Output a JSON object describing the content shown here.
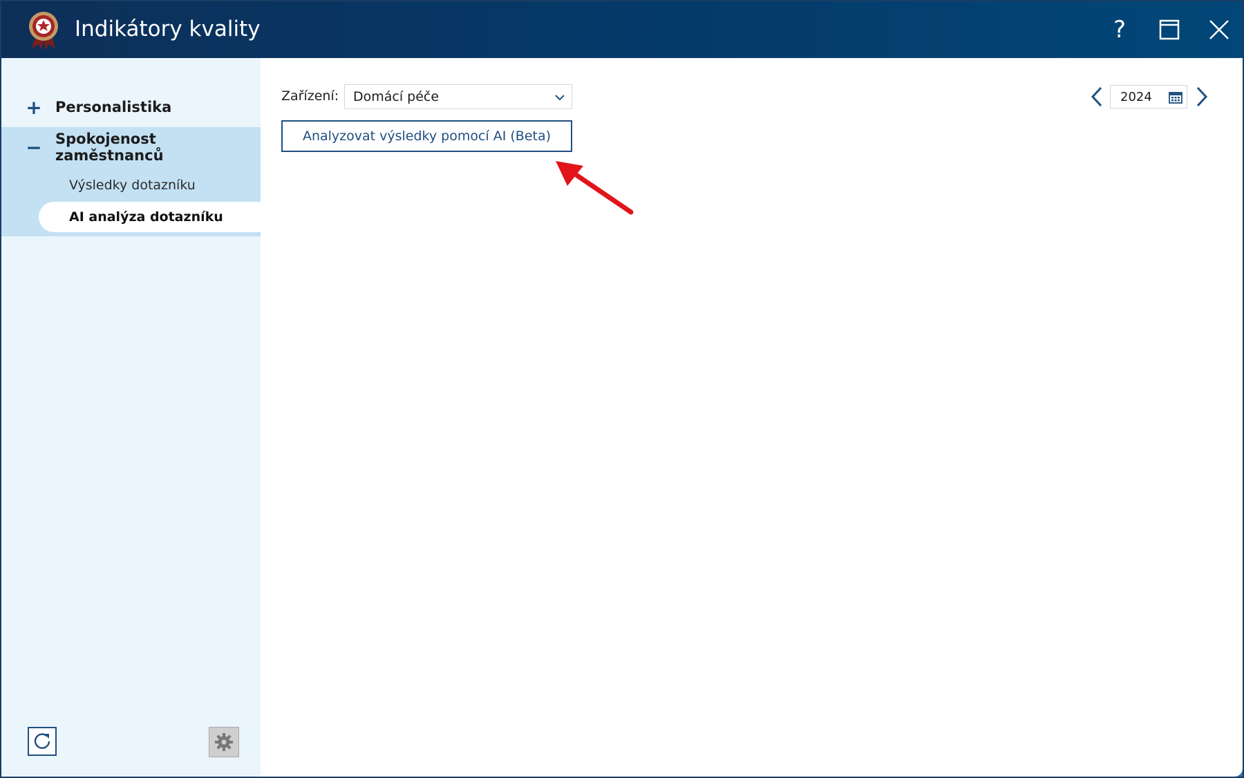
{
  "window": {
    "title": "Indikátory kvality",
    "help_label": "?"
  },
  "sidebar": {
    "groups": [
      {
        "sign": "+",
        "label": "Personalistika",
        "expanded": false
      },
      {
        "sign": "−",
        "label": "Spokojenost zaměstnanců",
        "expanded": true,
        "items": [
          {
            "label": "Výsledky dotazníku",
            "selected": false
          },
          {
            "label": "AI analýza dotazníku",
            "selected": true
          }
        ]
      }
    ]
  },
  "main": {
    "facility_label": "Zařízení:",
    "facility_value": "Domácí péče",
    "analyze_button": "Analyzovat výsledky pomocí AI (Beta)",
    "year": "2024"
  },
  "colors": {
    "titlebar": "#043a6a",
    "sidebar_bg": "#eaf5fc",
    "sidebar_selected_group": "#c3e1f3",
    "accent": "#1f4f7f",
    "annotation_arrow": "#e0141a"
  },
  "icons": {
    "logo": "award-badge-icon",
    "help": "question-icon",
    "maximize": "maximize-icon",
    "close": "close-icon",
    "refresh": "refresh-icon",
    "settings": "gear-icon",
    "calendar": "calendar-icon",
    "prev": "chevron-left-icon",
    "next": "chevron-right-icon"
  }
}
